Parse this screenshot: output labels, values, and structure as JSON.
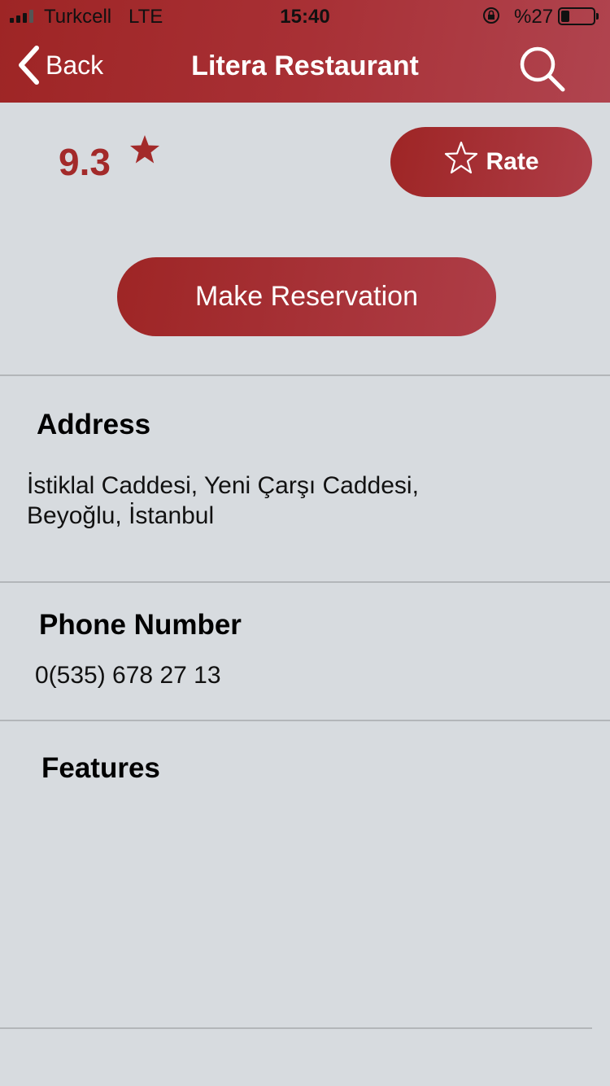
{
  "status_bar": {
    "carrier": "Turkcell",
    "network": "LTE",
    "time": "15:40",
    "battery_percent_label": "%27",
    "battery_level": 0.27
  },
  "nav": {
    "back_label": "Back",
    "title": "Litera Restaurant",
    "back_icon": "chevron-left-icon",
    "search_icon": "search-icon"
  },
  "rating": {
    "value": "9.3",
    "rate_label": "Rate"
  },
  "reserve": {
    "label": "Make Reservation"
  },
  "address": {
    "title": "Address",
    "line1": "İstiklal Caddesi, Yeni Çarşı Caddesi,",
    "line2": "Beyoğlu, İstanbul"
  },
  "phone": {
    "title": "Phone Number",
    "value": "0(535) 678 27 13"
  },
  "features": {
    "title": "Features"
  },
  "colors": {
    "accent": "#a32a2a",
    "background": "#d7dbdf",
    "divider": "#b3b6b9"
  }
}
